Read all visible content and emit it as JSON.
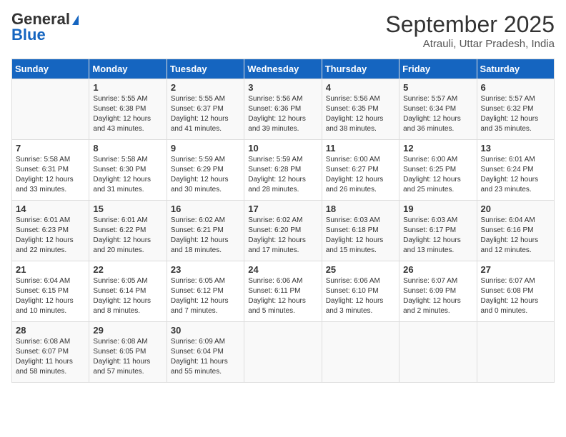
{
  "header": {
    "logo_general": "General",
    "logo_blue": "Blue",
    "month_year": "September 2025",
    "location": "Atrauli, Uttar Pradesh, India"
  },
  "days_of_week": [
    "Sunday",
    "Monday",
    "Tuesday",
    "Wednesday",
    "Thursday",
    "Friday",
    "Saturday"
  ],
  "weeks": [
    [
      {
        "num": "",
        "info": ""
      },
      {
        "num": "1",
        "info": "Sunrise: 5:55 AM\nSunset: 6:38 PM\nDaylight: 12 hours\nand 43 minutes."
      },
      {
        "num": "2",
        "info": "Sunrise: 5:55 AM\nSunset: 6:37 PM\nDaylight: 12 hours\nand 41 minutes."
      },
      {
        "num": "3",
        "info": "Sunrise: 5:56 AM\nSunset: 6:36 PM\nDaylight: 12 hours\nand 39 minutes."
      },
      {
        "num": "4",
        "info": "Sunrise: 5:56 AM\nSunset: 6:35 PM\nDaylight: 12 hours\nand 38 minutes."
      },
      {
        "num": "5",
        "info": "Sunrise: 5:57 AM\nSunset: 6:34 PM\nDaylight: 12 hours\nand 36 minutes."
      },
      {
        "num": "6",
        "info": "Sunrise: 5:57 AM\nSunset: 6:32 PM\nDaylight: 12 hours\nand 35 minutes."
      }
    ],
    [
      {
        "num": "7",
        "info": "Sunrise: 5:58 AM\nSunset: 6:31 PM\nDaylight: 12 hours\nand 33 minutes."
      },
      {
        "num": "8",
        "info": "Sunrise: 5:58 AM\nSunset: 6:30 PM\nDaylight: 12 hours\nand 31 minutes."
      },
      {
        "num": "9",
        "info": "Sunrise: 5:59 AM\nSunset: 6:29 PM\nDaylight: 12 hours\nand 30 minutes."
      },
      {
        "num": "10",
        "info": "Sunrise: 5:59 AM\nSunset: 6:28 PM\nDaylight: 12 hours\nand 28 minutes."
      },
      {
        "num": "11",
        "info": "Sunrise: 6:00 AM\nSunset: 6:27 PM\nDaylight: 12 hours\nand 26 minutes."
      },
      {
        "num": "12",
        "info": "Sunrise: 6:00 AM\nSunset: 6:25 PM\nDaylight: 12 hours\nand 25 minutes."
      },
      {
        "num": "13",
        "info": "Sunrise: 6:01 AM\nSunset: 6:24 PM\nDaylight: 12 hours\nand 23 minutes."
      }
    ],
    [
      {
        "num": "14",
        "info": "Sunrise: 6:01 AM\nSunset: 6:23 PM\nDaylight: 12 hours\nand 22 minutes."
      },
      {
        "num": "15",
        "info": "Sunrise: 6:01 AM\nSunset: 6:22 PM\nDaylight: 12 hours\nand 20 minutes."
      },
      {
        "num": "16",
        "info": "Sunrise: 6:02 AM\nSunset: 6:21 PM\nDaylight: 12 hours\nand 18 minutes."
      },
      {
        "num": "17",
        "info": "Sunrise: 6:02 AM\nSunset: 6:20 PM\nDaylight: 12 hours\nand 17 minutes."
      },
      {
        "num": "18",
        "info": "Sunrise: 6:03 AM\nSunset: 6:18 PM\nDaylight: 12 hours\nand 15 minutes."
      },
      {
        "num": "19",
        "info": "Sunrise: 6:03 AM\nSunset: 6:17 PM\nDaylight: 12 hours\nand 13 minutes."
      },
      {
        "num": "20",
        "info": "Sunrise: 6:04 AM\nSunset: 6:16 PM\nDaylight: 12 hours\nand 12 minutes."
      }
    ],
    [
      {
        "num": "21",
        "info": "Sunrise: 6:04 AM\nSunset: 6:15 PM\nDaylight: 12 hours\nand 10 minutes."
      },
      {
        "num": "22",
        "info": "Sunrise: 6:05 AM\nSunset: 6:14 PM\nDaylight: 12 hours\nand 8 minutes."
      },
      {
        "num": "23",
        "info": "Sunrise: 6:05 AM\nSunset: 6:12 PM\nDaylight: 12 hours\nand 7 minutes."
      },
      {
        "num": "24",
        "info": "Sunrise: 6:06 AM\nSunset: 6:11 PM\nDaylight: 12 hours\nand 5 minutes."
      },
      {
        "num": "25",
        "info": "Sunrise: 6:06 AM\nSunset: 6:10 PM\nDaylight: 12 hours\nand 3 minutes."
      },
      {
        "num": "26",
        "info": "Sunrise: 6:07 AM\nSunset: 6:09 PM\nDaylight: 12 hours\nand 2 minutes."
      },
      {
        "num": "27",
        "info": "Sunrise: 6:07 AM\nSunset: 6:08 PM\nDaylight: 12 hours\nand 0 minutes."
      }
    ],
    [
      {
        "num": "28",
        "info": "Sunrise: 6:08 AM\nSunset: 6:07 PM\nDaylight: 11 hours\nand 58 minutes."
      },
      {
        "num": "29",
        "info": "Sunrise: 6:08 AM\nSunset: 6:05 PM\nDaylight: 11 hours\nand 57 minutes."
      },
      {
        "num": "30",
        "info": "Sunrise: 6:09 AM\nSunset: 6:04 PM\nDaylight: 11 hours\nand 55 minutes."
      },
      {
        "num": "",
        "info": ""
      },
      {
        "num": "",
        "info": ""
      },
      {
        "num": "",
        "info": ""
      },
      {
        "num": "",
        "info": ""
      }
    ]
  ]
}
